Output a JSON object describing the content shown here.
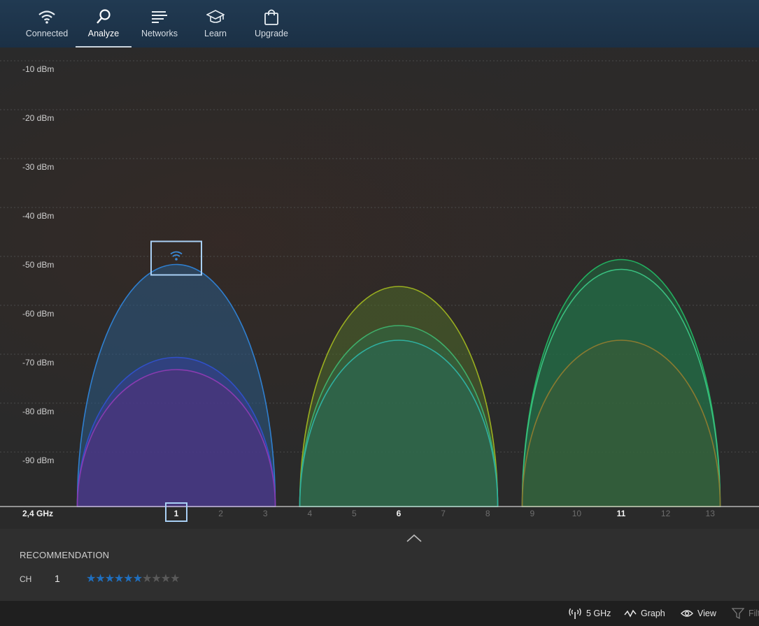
{
  "nav": {
    "items": [
      {
        "label": "Connected",
        "icon": "wifi-icon",
        "active": false
      },
      {
        "label": "Analyze",
        "icon": "magnifier-icon",
        "active": true
      },
      {
        "label": "Networks",
        "icon": "networks-list-icon",
        "active": false
      },
      {
        "label": "Learn",
        "icon": "graduation-cap-icon",
        "active": false
      },
      {
        "label": "Upgrade",
        "icon": "shopping-bag-icon",
        "active": false
      }
    ]
  },
  "chart_data": {
    "type": "area",
    "band_label": "2,4 GHz",
    "y_ticks": [
      {
        "value": -10,
        "label": "-10 dBm"
      },
      {
        "value": -20,
        "label": "-20 dBm"
      },
      {
        "value": -30,
        "label": "-30 dBm"
      },
      {
        "value": -40,
        "label": "-40 dBm"
      },
      {
        "value": -50,
        "label": "-50 dBm"
      },
      {
        "value": -60,
        "label": "-60 dBm"
      },
      {
        "value": -70,
        "label": "-70 dBm"
      },
      {
        "value": -80,
        "label": "-80 dBm"
      },
      {
        "value": -90,
        "label": "-90 dBm"
      }
    ],
    "ylim": [
      -100,
      -5
    ],
    "x_ticks": [
      "1",
      "2",
      "3",
      "4",
      "5",
      "6",
      "7",
      "8",
      "9",
      "10",
      "11",
      "12",
      "13"
    ],
    "highlighted_x_ticks": [
      "1",
      "6",
      "11"
    ],
    "selected_channel": "1",
    "grid": true,
    "networks": [
      {
        "channel": 1,
        "width_channels": 4.45,
        "peak_dbm": -50.5,
        "color": "#2f7fcf",
        "fill": "#2a5a86",
        "connected": true
      },
      {
        "channel": 1,
        "width_channels": 4.45,
        "peak_dbm": -69.5,
        "color": "#3050c8",
        "fill": "#34409a",
        "connected": false
      },
      {
        "channel": 1,
        "width_channels": 4.45,
        "peak_dbm": -72,
        "color": "#8a3bb0",
        "fill": "#55307a",
        "connected": false
      },
      {
        "channel": 6,
        "width_channels": 4.45,
        "peak_dbm": -55,
        "color": "#9aaf20",
        "fill": "#4f6a2a",
        "connected": false
      },
      {
        "channel": 6,
        "width_channels": 4.45,
        "peak_dbm": -63,
        "color": "#3fae6a",
        "fill": "#2f6a45",
        "connected": false
      },
      {
        "channel": 6,
        "width_channels": 4.45,
        "peak_dbm": -66,
        "color": "#2fb0a0",
        "fill": "#2a6a55",
        "connected": false
      },
      {
        "channel": 11,
        "width_channels": 4.45,
        "peak_dbm": -49.5,
        "color": "#22b060",
        "fill": "#1f6a40",
        "connected": false
      },
      {
        "channel": 11,
        "width_channels": 4.45,
        "peak_dbm": -51.5,
        "color": "#3ac080",
        "fill": "#257048",
        "connected": false
      },
      {
        "channel": 11,
        "width_channels": 4.45,
        "peak_dbm": -66,
        "color": "#8a7a30",
        "fill": "#3e5a35",
        "connected": false
      }
    ]
  },
  "recommendation": {
    "title": "RECOMMENDATION",
    "ch_label": "CH",
    "ch_value": "1",
    "rating": 6,
    "rating_max": 10
  },
  "statusbar": {
    "band_button": "5 GHz",
    "graph_button": "Graph",
    "view_button": "View",
    "filter_button": "Filter",
    "icons": [
      "antenna-icon",
      "graph-line-icon",
      "eye-icon",
      "filter-icon"
    ]
  }
}
